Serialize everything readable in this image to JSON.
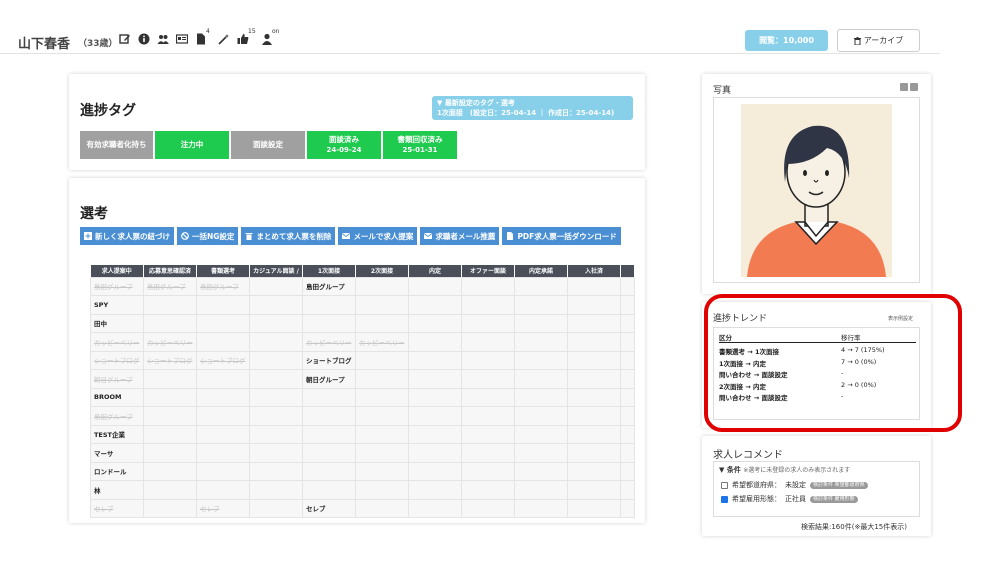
{
  "header": {
    "name": "山下春香",
    "age": "（33歳）",
    "icons": [
      "edit-icon",
      "info-icon",
      "users-icon",
      "id-card-icon",
      "document-icon",
      "magic-wand-icon",
      "thumbs-up-icon",
      "person-on-icon"
    ],
    "doc_count": "4",
    "like_count": "15",
    "person_status": "on",
    "views_label": "閲覧：10,000",
    "archive_label": "アーカイブ"
  },
  "tags_card": {
    "title": "進捗タグ",
    "recent_title": "▼ 最新設定のタグ・選考",
    "recent_detail": "1次面接　(設定日：25-04-14 ｜ 作成日：25-04-14)",
    "tags": [
      {
        "label": "有効求職者化持ち",
        "date": "",
        "color": "#a0a0a0"
      },
      {
        "label": "注力中",
        "date": "",
        "color": "#1ecb4f"
      },
      {
        "label": "面談設定",
        "date": "",
        "color": "#a0a0a0"
      },
      {
        "label": "面談済み",
        "date": "24-09-24",
        "color": "#1ecb4f"
      },
      {
        "label": "書類回収済み",
        "date": "25-01-31",
        "color": "#1ecb4f"
      }
    ]
  },
  "selection_card": {
    "title": "選考",
    "actions": [
      {
        "label": "新しく求人票の紐づけ",
        "icon": "plus-square-icon"
      },
      {
        "label": "一括NG設定",
        "icon": "ban-icon"
      },
      {
        "label": "まとめて求人票を削除",
        "icon": "trash-icon"
      },
      {
        "label": "メールで求人提案",
        "icon": "mail-icon"
      },
      {
        "label": "求職者メール推薦",
        "icon": "mail-icon"
      },
      {
        "label": "PDF求人票一括ダウンロード",
        "icon": "file-icon"
      }
    ],
    "columns": [
      "求人提案中",
      "応募意思確認済",
      "書類選考",
      "カジュアル面談 / ",
      "1次面接",
      "2次面接",
      "内定",
      "オファー面談",
      "内定承諾",
      "入社済",
      ""
    ],
    "rows": [
      {
        "cells": [
          "島田グループ",
          "島田グループ",
          "島田グループ",
          "",
          "島田グループ",
          "",
          "",
          "",
          "",
          "",
          ""
        ],
        "struck": [
          true,
          true,
          true,
          false,
          false,
          false,
          false,
          false,
          false,
          false,
          false
        ]
      },
      {
        "cells": [
          "SPY",
          "",
          "",
          "",
          "",
          "",
          "",
          "",
          "",
          "",
          ""
        ],
        "struck": [
          false,
          false,
          false,
          false,
          false,
          false,
          false,
          false,
          false,
          false,
          false
        ]
      },
      {
        "cells": [
          "田中",
          "",
          "",
          "",
          "",
          "",
          "",
          "",
          "",
          "",
          ""
        ],
        "struck": [
          false,
          false,
          false,
          false,
          false,
          false,
          false,
          false,
          false,
          false,
          false
        ]
      },
      {
        "cells": [
          "カッピーベリー",
          "カッピーベリー",
          "",
          "",
          "カッピーベリー",
          "カッピーベリー",
          "",
          "",
          "",
          "",
          ""
        ],
        "struck": [
          true,
          true,
          false,
          false,
          true,
          true,
          false,
          false,
          false,
          false,
          false
        ]
      },
      {
        "cells": [
          "ショートブログ",
          "ショートブログ",
          "ショートブログ",
          "",
          "ショートブログ",
          "",
          "",
          "",
          "",
          "",
          ""
        ],
        "struck": [
          true,
          true,
          true,
          false,
          false,
          false,
          false,
          false,
          false,
          false,
          false
        ]
      },
      {
        "cells": [
          "朝日グループ",
          "",
          "",
          "",
          "朝日グループ",
          "",
          "",
          "",
          "",
          "",
          ""
        ],
        "struck": [
          true,
          false,
          false,
          false,
          false,
          false,
          false,
          false,
          false,
          false,
          false
        ]
      },
      {
        "cells": [
          "BROOM",
          "",
          "",
          "",
          "",
          "",
          "",
          "",
          "",
          "",
          ""
        ],
        "struck": [
          false,
          false,
          false,
          false,
          false,
          false,
          false,
          false,
          false,
          false,
          false
        ]
      },
      {
        "cells": [
          "島田グループ",
          "",
          "",
          "",
          "",
          "",
          "",
          "",
          "",
          "",
          ""
        ],
        "struck": [
          true,
          false,
          false,
          false,
          false,
          false,
          false,
          false,
          false,
          false,
          false
        ]
      },
      {
        "cells": [
          "TEST企業",
          "",
          "",
          "",
          "",
          "",
          "",
          "",
          "",
          "",
          ""
        ],
        "struck": [
          false,
          false,
          false,
          false,
          false,
          false,
          false,
          false,
          false,
          false,
          false
        ]
      },
      {
        "cells": [
          "マーサ",
          "",
          "",
          "",
          "",
          "",
          "",
          "",
          "",
          "",
          ""
        ],
        "struck": [
          false,
          false,
          false,
          false,
          false,
          false,
          false,
          false,
          false,
          false,
          false
        ]
      },
      {
        "cells": [
          "ロンドール",
          "",
          "",
          "",
          "",
          "",
          "",
          "",
          "",
          "",
          ""
        ],
        "struck": [
          false,
          false,
          false,
          false,
          false,
          false,
          false,
          false,
          false,
          false,
          false
        ]
      },
      {
        "cells": [
          "林",
          "",
          "",
          "",
          "",
          "",
          "",
          "",
          "",
          "",
          ""
        ],
        "struck": [
          false,
          false,
          false,
          false,
          false,
          false,
          false,
          false,
          false,
          false,
          false
        ]
      },
      {
        "cells": [
          "セレブ",
          "",
          "セレブ",
          "",
          "セレブ",
          "",
          "",
          "",
          "",
          "",
          ""
        ],
        "struck": [
          true,
          false,
          true,
          false,
          false,
          false,
          false,
          false,
          false,
          false,
          false
        ]
      }
    ]
  },
  "photo_card": {
    "title": "写真"
  },
  "trend_card": {
    "title": "進捗トレンド",
    "setting_label": "表示例設定",
    "col_headers": [
      "区分",
      "移行率"
    ],
    "rows": [
      {
        "label": "書類選考 → 1次面接",
        "value": "4 → 7 (175%)"
      },
      {
        "label": "1次面接 → 内定",
        "value": "7 → 0 (0%)"
      },
      {
        "label": "問い合わせ → 面談設定",
        "value": "-"
      },
      {
        "label": "2次面接 → 内定",
        "value": "2 → 0 (0%)"
      },
      {
        "label": "問い合わせ → 面談設定",
        "value": "-"
      }
    ]
  },
  "recommend_card": {
    "title": "求人レコメンド",
    "condition_label": "▼ 条件",
    "condition_note": "※選考に未登録の求人のみ表示されます",
    "conditions": [
      {
        "label": "希望都道府県：",
        "value": "未設定",
        "pill": "検討条件 希望都道府県",
        "checked": false
      },
      {
        "label": "希望雇用形態：",
        "value": "正社員",
        "pill": "検討条件 雇用形態",
        "checked": true
      }
    ],
    "result": "検索結果:160件(※最大15件表示)"
  }
}
